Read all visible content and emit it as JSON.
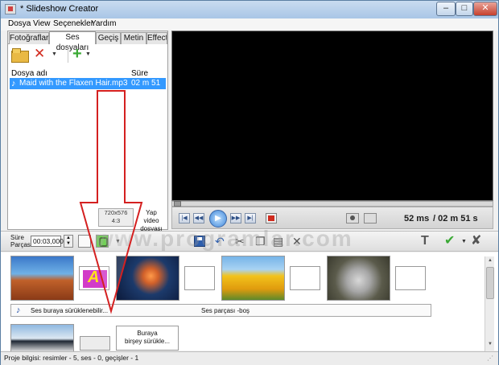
{
  "window": {
    "title": "* Slideshow Creator",
    "min": "–",
    "max": "□",
    "close": "✕"
  },
  "menu": [
    "Dosya",
    "View",
    "Seçenekler",
    "Yardım"
  ],
  "tabs": [
    "Fotoğraflar",
    "Ses dosyaları",
    "Geçiş",
    "Metin",
    "Effects"
  ],
  "file_list": {
    "col_name": "Dosya adı",
    "col_duration": "Süre",
    "rows": [
      {
        "name": "Maid with the Flaxen Hair.mp3",
        "duration": "02 m 51 s"
      }
    ]
  },
  "resolution": {
    "line1": "720x576",
    "line2": "4:3"
  },
  "make_video": {
    "line1": "Yap",
    "line2": "video dosyası"
  },
  "player": {
    "current": "52 ms",
    "total": "/ 02 m 51 s"
  },
  "toolbar": {
    "duration_label_1": "Süre",
    "duration_label_2": "Parçası",
    "duration_value": "00:03,000"
  },
  "watermark": "www.programlar.com",
  "timeline": {
    "audio_hint": "Ses buraya sürüklenebilir...",
    "audio_empty": "Ses parçası -boş",
    "drop_line1": "Buraya",
    "drop_line2": "birşey sürükle..."
  },
  "status": "Proje bilgisi: resimler - 5, ses - 0, geçişler - 1",
  "icons": [
    "folder-icon",
    "delete-icon",
    "add-icon",
    "music-note-icon",
    "play-icon",
    "stop-icon",
    "camera-icon",
    "fullscreen-icon",
    "save-icon",
    "undo-icon",
    "cut-icon",
    "copy-icon",
    "paste-icon",
    "remove-icon",
    "text-icon",
    "check-icon",
    "cancel-icon"
  ]
}
